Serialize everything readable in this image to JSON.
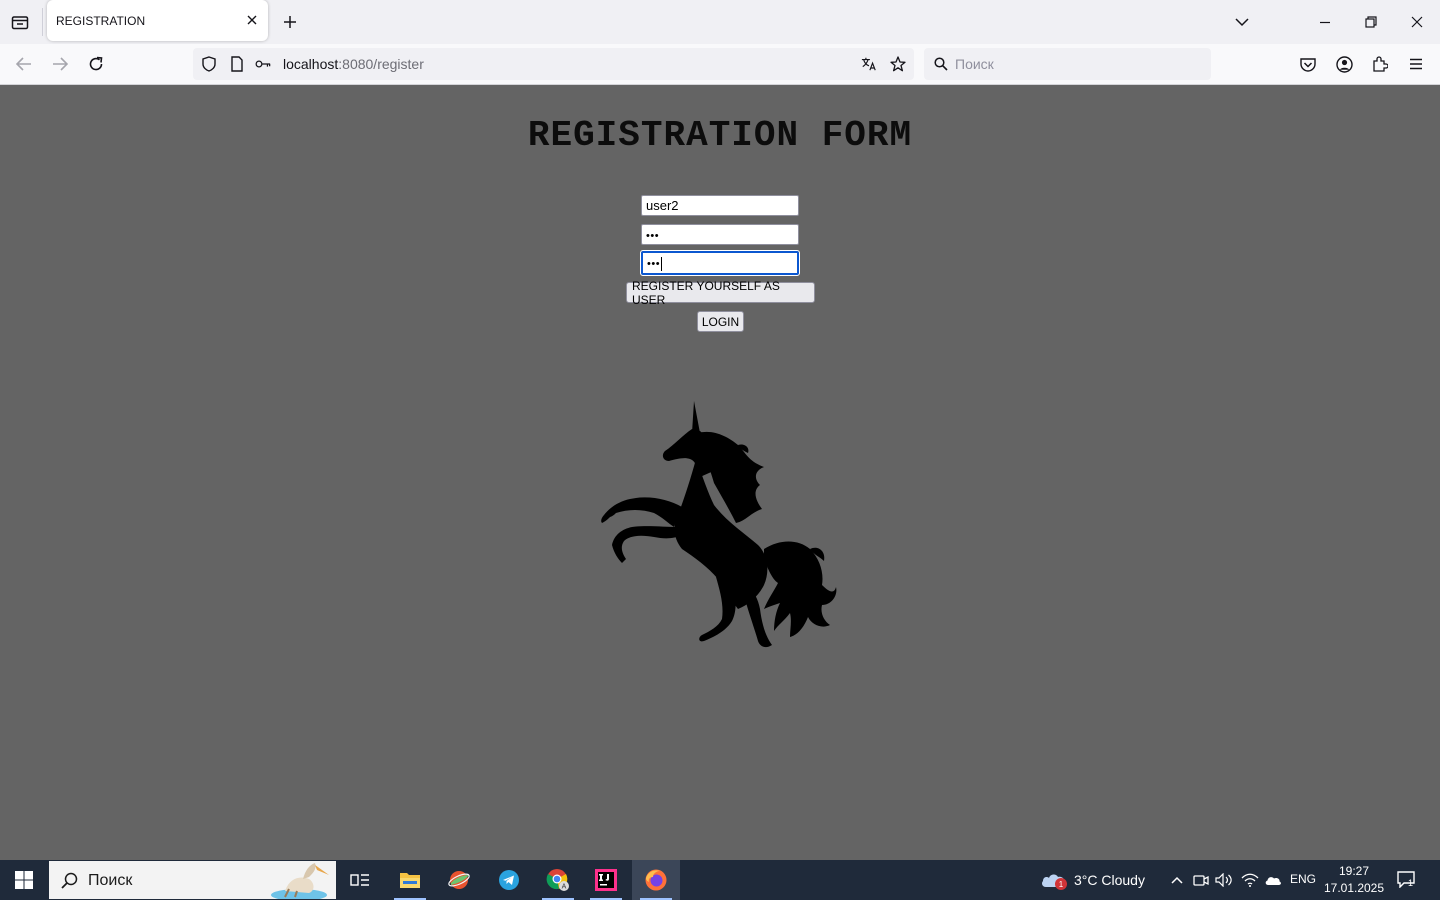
{
  "browser": {
    "tab": {
      "title": "REGISTRATION"
    },
    "url": {
      "host": "localhost",
      "rest": ":8080/register"
    },
    "search": {
      "placeholder": "Поиск"
    }
  },
  "page": {
    "title": "REGISTRATION FORM",
    "username_value": "user2",
    "password_dots": "•••",
    "confirm_dots": "•••",
    "register_label": "REGISTER YOURSELF AS USER",
    "login_label": "LOGIN"
  },
  "taskbar": {
    "search_placeholder": "Поиск",
    "weather": {
      "text": "3°C  Cloudy",
      "badge": "1"
    },
    "language": "ENG",
    "time": "19:27",
    "date": "17.01.2025",
    "notifications": "1",
    "apps": [
      "task-view",
      "file-explorer",
      "browser-app",
      "telegram",
      "chrome",
      "intellij-idea",
      "firefox"
    ]
  },
  "colors": {
    "page_background": "#646464",
    "focus_ring": "#0b57d0",
    "taskbar": "#1f2a3a"
  }
}
